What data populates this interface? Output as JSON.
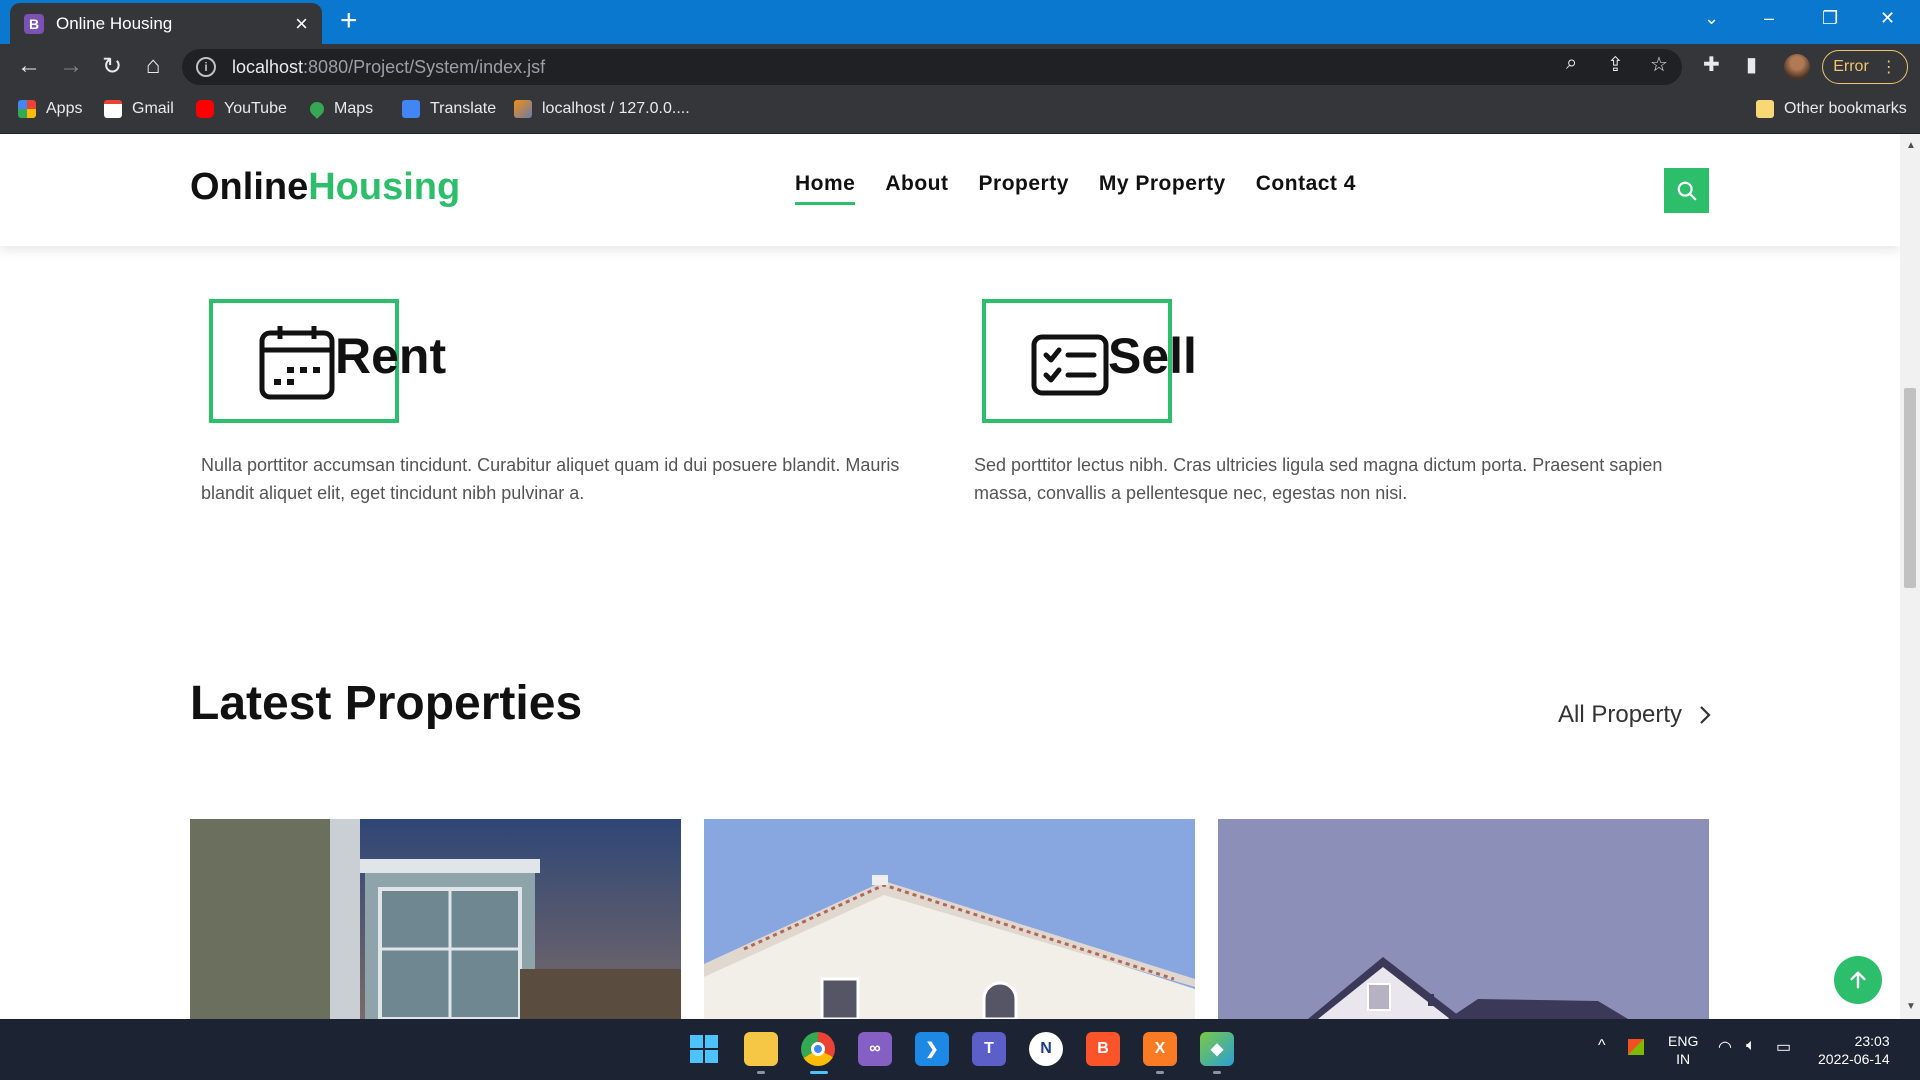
{
  "browser": {
    "tab_title": "Online Housing",
    "tab_favicon_letter": "B",
    "url_host": "localhost",
    "url_rest": ":8080/Project/System/index.jsf",
    "error_label": "Error",
    "bookmarks": [
      {
        "label": "Apps",
        "icon": "apps-grid-icon",
        "color": "#4285f4"
      },
      {
        "label": "Gmail",
        "icon": "gmail-icon",
        "color": "#ea4335"
      },
      {
        "label": "YouTube",
        "icon": "youtube-icon",
        "color": "#ff0000"
      },
      {
        "label": "Maps",
        "icon": "maps-icon",
        "color": "#34a853"
      },
      {
        "label": "Translate",
        "icon": "translate-icon",
        "color": "#4285f4"
      },
      {
        "label": "localhost / 127.0.0....",
        "icon": "phpmyadmin-icon",
        "color": "#f29111"
      }
    ],
    "other_bookmarks": "Other bookmarks"
  },
  "site": {
    "logo_part1": "Online",
    "logo_part2": "Housing",
    "accent_color": "#2dbe6c",
    "nav": [
      {
        "label": "Home",
        "active": true
      },
      {
        "label": "About"
      },
      {
        "label": "Property"
      },
      {
        "label": "My Property"
      },
      {
        "label": "Contact 4"
      }
    ]
  },
  "services": [
    {
      "title": "Rent",
      "icon": "calendar-icon",
      "text": "Nulla porttitor accumsan tincidunt. Curabitur aliquet quam id dui posuere blandit. Mauris blandit aliquet elit, eget tincidunt nibh pulvinar a."
    },
    {
      "title": "Sell",
      "icon": "list-check-icon",
      "text": "Sed porttitor lectus nibh. Cras ultricies ligula sed magna dictum porta. Praesent sapien massa, convallis a pellentesque nec, egestas non nisi."
    }
  ],
  "latest": {
    "title": "Latest Properties",
    "all_link": "All Property"
  },
  "taskbar": {
    "lang_line1": "ENG",
    "lang_line2": "IN",
    "time": "23:03",
    "date": "2022-06-14"
  }
}
